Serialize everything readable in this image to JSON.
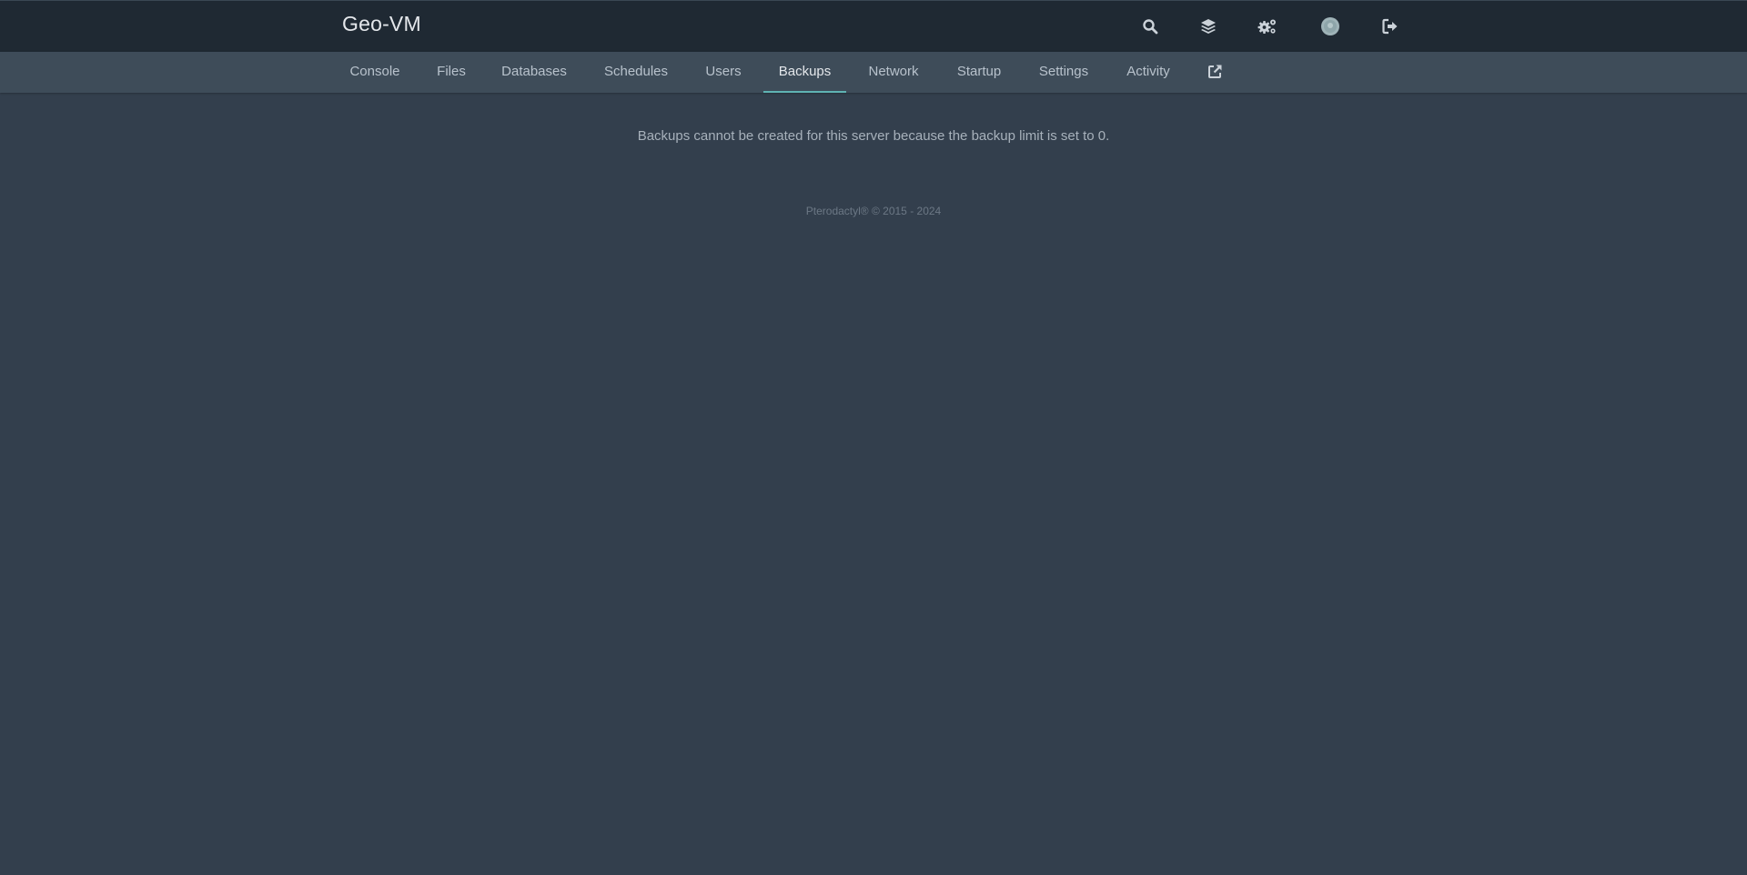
{
  "header": {
    "title": "Geo-VM",
    "icons": [
      "search-icon",
      "layers-icon",
      "cogs-icon",
      "avatar",
      "sign-out-icon"
    ]
  },
  "tabs": [
    {
      "label": "Console"
    },
    {
      "label": "Files"
    },
    {
      "label": "Databases"
    },
    {
      "label": "Schedules"
    },
    {
      "label": "Users"
    },
    {
      "label": "Backups",
      "active": true
    },
    {
      "label": "Network"
    },
    {
      "label": "Startup"
    },
    {
      "label": "Settings"
    },
    {
      "label": "Activity"
    }
  ],
  "external_link_icon": "external-link-icon",
  "main": {
    "notice": "Backups cannot be created for this server because the backup limit is set to 0."
  },
  "footer": {
    "text": "Pterodactyl® © 2015 - 2024"
  },
  "colors": {
    "topbar": "#1f2933",
    "subnav": "#3e4c59",
    "background": "#333f4d",
    "active_tab_underline": "#5fb3b3"
  }
}
